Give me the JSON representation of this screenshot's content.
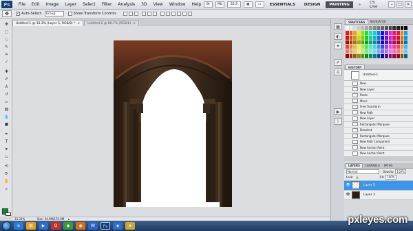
{
  "app": {
    "logo": "Ps",
    "menus": [
      "File",
      "Edit",
      "Image",
      "Layer",
      "Select",
      "Filter",
      "Analysis",
      "3D",
      "View",
      "Window",
      "Help"
    ],
    "zoom": "33.3",
    "workspaces": [
      "ESSENTIALS",
      "DESIGN",
      "PAINTING"
    ],
    "cs_live": "CS Live"
  },
  "options_bar": {
    "auto_select_label": "Auto-Select:",
    "auto_select_value": "Group",
    "show_transform_label": "Show Transform Controls"
  },
  "doc_tabs": [
    {
      "label": "Untitled-1 @ 33.3% (Layer 5, RGB/8) *"
    },
    {
      "label": "Untitled-2 @ 66.7% (RGB/8)"
    }
  ],
  "status": {
    "zoom": "33.33%",
    "doc": "Doc: 24.9M/170.0M"
  },
  "panels": {
    "swatches_tabs": [
      "SWATCHES",
      "NAVIGATOR"
    ],
    "history_title": "HISTORY",
    "history_snapshot": "Untitled-1",
    "history_items": [
      "New",
      "New Layer",
      "Paste",
      "Move",
      "Free Transform",
      "New Path",
      "New Layer",
      "Rectangular Marquee",
      "Deselect",
      "Rectangular Marquee",
      "New Path Component",
      "New Anchor Point",
      "New Anchor Point"
    ],
    "layers_tabs": [
      "LAYERS",
      "CHANNELS",
      "PATHS"
    ],
    "blend_mode": "Normal",
    "opacity_label": "Opacity:",
    "opacity_value": "100%",
    "lock_label": "Lock:",
    "fill_label": "Fill:",
    "fill_value": "100%",
    "layers": [
      {
        "name": "Layer 5",
        "selected": true
      },
      {
        "name": "Layer 3",
        "selected": false
      }
    ]
  },
  "colors": {
    "accent_selected": "#3c95e6",
    "foreground": "#0b8a29",
    "taskbar": "#2a4a73"
  },
  "watermark": "pxleyes.com"
}
